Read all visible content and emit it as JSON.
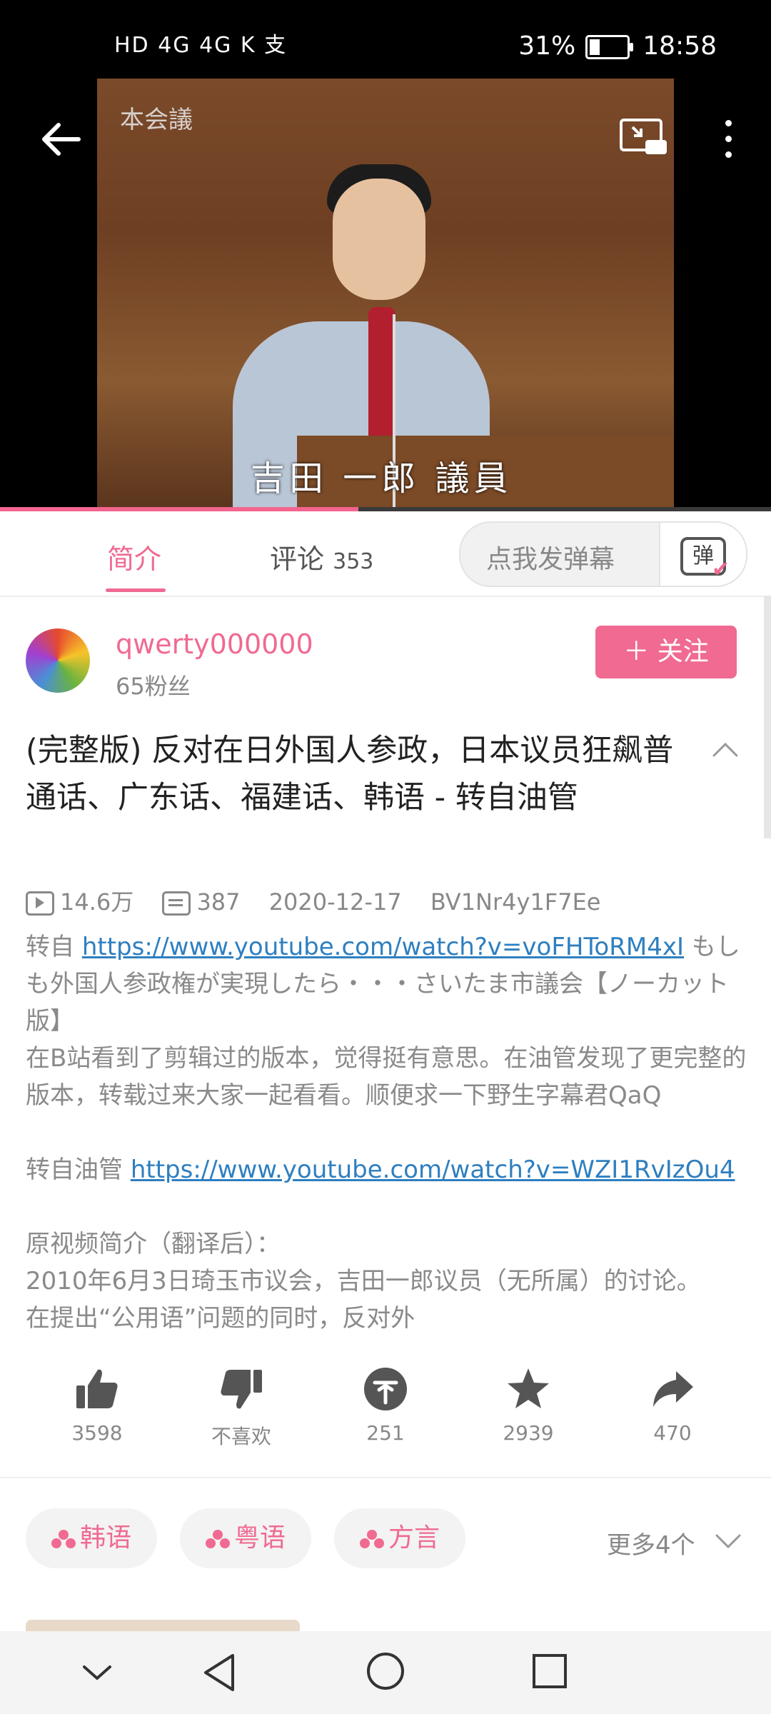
{
  "status_bar": {
    "left": "HD 4G 4G K 支",
    "battery_percent": "31%",
    "time": "18:58"
  },
  "video": {
    "overlay_label": "本会議",
    "subtitle": "吉田  一郎  議員",
    "progress_fraction": 0.465
  },
  "tabs": {
    "intro_label": "简介",
    "comments_label": "评论",
    "comments_count": "353",
    "danmaku_placeholder": "点我发弹幕",
    "danmaku_icon_char": "弹"
  },
  "uploader": {
    "name": "qwerty000000",
    "fans": "65粉丝",
    "follow_label": "＋ 关注"
  },
  "video_info": {
    "title": "(完整版) 反对在日外国人参政，日本议员狂飙普通话、广东话、福建话、韩语 - 转自油管",
    "views": "14.6万",
    "danmaku_count": "387",
    "date": "2020-12-17",
    "bvid": "BV1Nr4y1F7Ee"
  },
  "description": {
    "p1_prefix": "转自 ",
    "p1_link": "https://www.youtube.com/watch?v=voFHToRM4xI",
    "p1_suffix": " もしも外国人参政権が実現したら・・・さいたま市議会【ノーカット版】",
    "p2": "在B站看到了剪辑过的版本，觉得挺有意思。在油管发现了更完整的版本，转载过来大家一起看看。顺便求一下野生字幕君QaQ",
    "p3_prefix": "转自油管 ",
    "p3_link": "https://www.youtube.com/watch?v=WZI1RvIzOu4",
    "p4": "原视频简介（翻译后）：",
    "p5": "2010年6月3日琦玉市议会，吉田一郎议员（无所属）的讨论。",
    "p6": "在提出“公用语”问题的同时，反对外"
  },
  "actions": {
    "like": "3598",
    "dislike": "不喜欢",
    "coin": "251",
    "favorite": "2939",
    "share": "470"
  },
  "tags": {
    "items": [
      "韩语",
      "粤语",
      "方言"
    ],
    "more": "更多4个"
  },
  "colors": {
    "accent": "#f06a91",
    "link": "#2e7fc0"
  }
}
